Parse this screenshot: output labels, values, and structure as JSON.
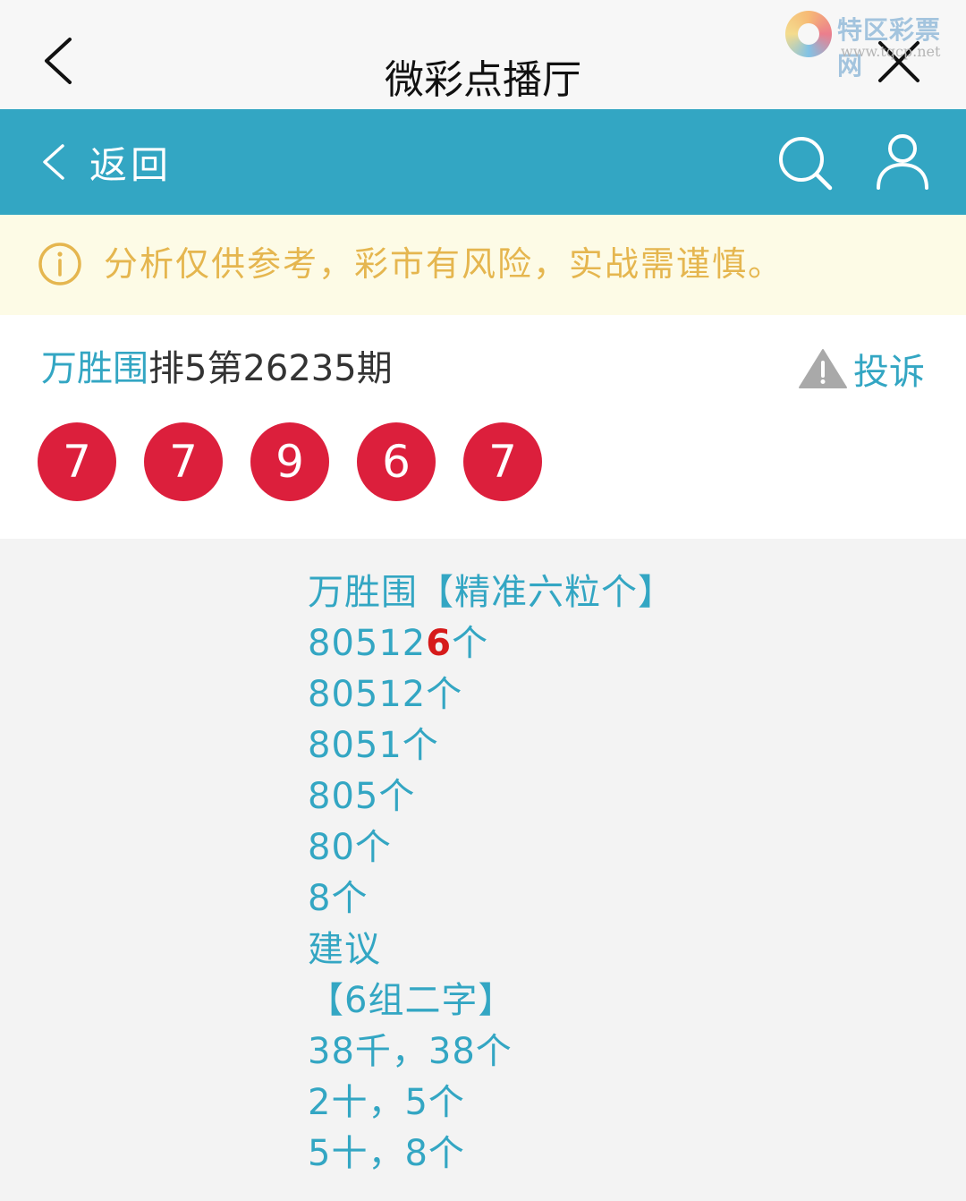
{
  "topbar": {
    "title": "微彩点播厅",
    "back_icon": "chevron-left-icon",
    "close_icon": "close-icon"
  },
  "watermark": {
    "name": "特区彩票网",
    "url": "www.tqcp.net"
  },
  "navbar": {
    "back_label": "返回",
    "search_icon": "search-icon",
    "user_icon": "user-icon",
    "color": "#33a6c3"
  },
  "notice": {
    "text": "分析仅供参考，彩市有风险，实战需谨慎。",
    "color": "#e5b64f"
  },
  "card": {
    "author": "万胜围",
    "issue": "排5第26235期",
    "complain_label": "投诉",
    "balls": [
      "7",
      "7",
      "9",
      "6",
      "7"
    ],
    "ball_color": "#dc1f3c"
  },
  "content": {
    "line1": "万胜围【精准六粒个】",
    "line2_prefix": "80512",
    "line2_highlight": "6",
    "line2_suffix": "个",
    "line3": "80512个",
    "line4": "8051个",
    "line5": "805个",
    "line6": "80个",
    "line7": "8个",
    "line8": "建议",
    "line9": "【6组二字】",
    "line10": "38千，38个",
    "line11": "2十，5个",
    "line12": "5十，8个",
    "highlight_color": "#d61a1a"
  }
}
